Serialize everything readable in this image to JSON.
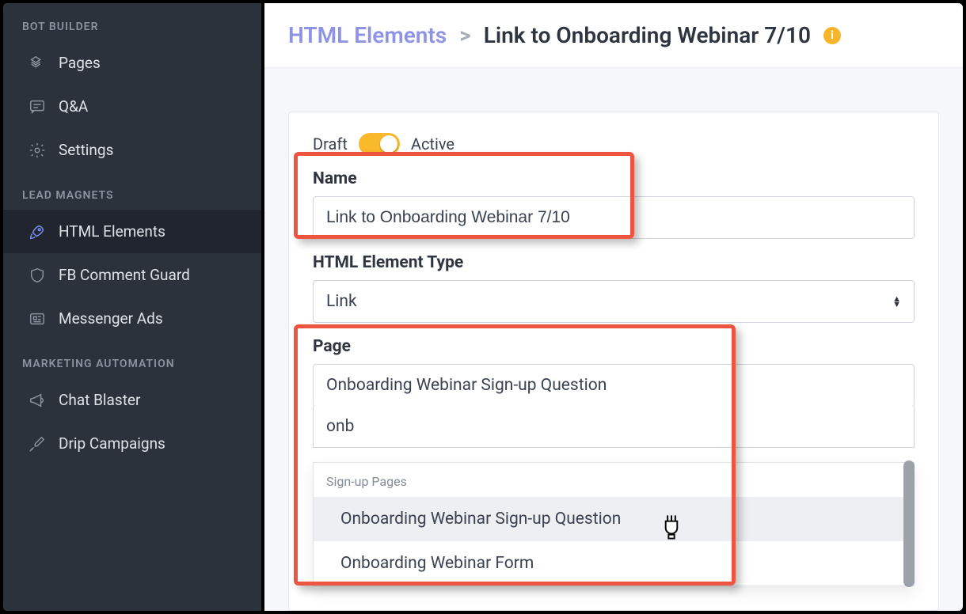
{
  "sidebar": {
    "sections": [
      {
        "label": "BOT BUILDER",
        "items": [
          {
            "label": "Pages",
            "icon": "pages-icon"
          },
          {
            "label": "Q&A",
            "icon": "qa-icon"
          },
          {
            "label": "Settings",
            "icon": "gear-icon"
          }
        ]
      },
      {
        "label": "LEAD MAGNETS",
        "items": [
          {
            "label": "HTML Elements",
            "icon": "rocket-icon",
            "active": true
          },
          {
            "label": "FB Comment Guard",
            "icon": "shield-icon"
          },
          {
            "label": "Messenger Ads",
            "icon": "news-icon"
          }
        ]
      },
      {
        "label": "MARKETING AUTOMATION",
        "items": [
          {
            "label": "Chat Blaster",
            "icon": "bullhorn-icon"
          },
          {
            "label": "Drip Campaigns",
            "icon": "dropper-icon"
          }
        ]
      }
    ]
  },
  "breadcrumb": {
    "parent": "HTML Elements",
    "sep": ">",
    "title": "Link to Onboarding Webinar 7/10"
  },
  "status": {
    "draft_label": "Draft",
    "active_label": "Active",
    "is_active": true
  },
  "form": {
    "name_label": "Name",
    "name_value": "Link to Onboarding Webinar 7/10",
    "type_label": "HTML Element Type",
    "type_value": "Link",
    "page_label": "Page",
    "page_value": "Onboarding Webinar Sign-up Question",
    "page_search": "onb",
    "page_group": "Sign-up Pages",
    "page_options": [
      "Onboarding Webinar Sign-up Question",
      "Onboarding Webinar Form"
    ]
  }
}
